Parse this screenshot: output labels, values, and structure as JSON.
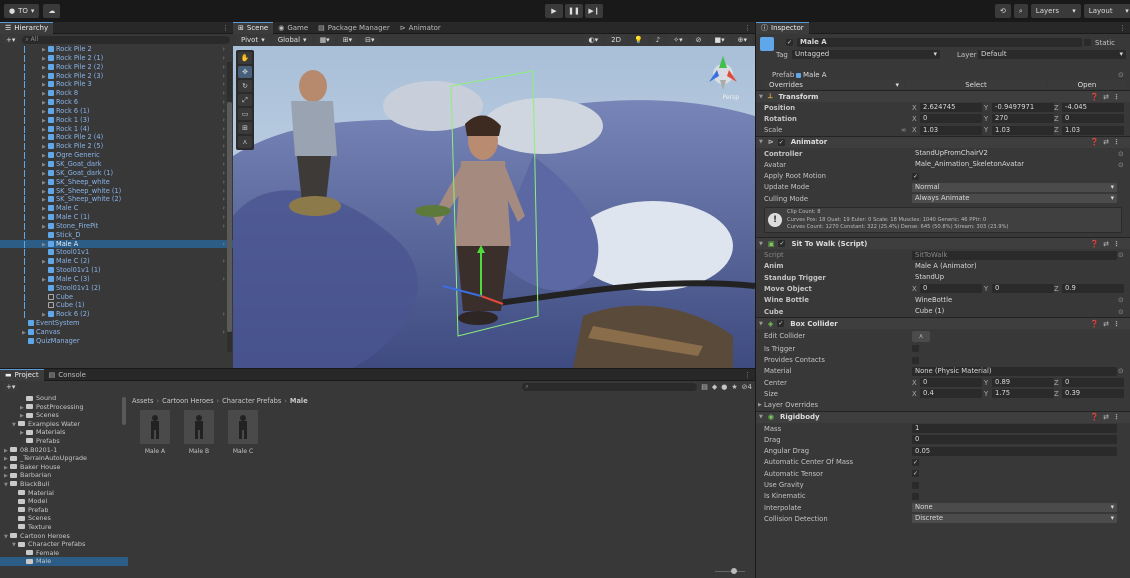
{
  "toolbar": {
    "account": "TO",
    "layers": "Layers",
    "layout": "Layout"
  },
  "hierarchy": {
    "title": "Hierarchy",
    "search": "All",
    "items": [
      {
        "label": "Rock Pile 2",
        "fold": true,
        "type": "prefab"
      },
      {
        "label": "Rock Pile 2 (1)",
        "fold": true,
        "type": "prefab"
      },
      {
        "label": "Rock Pile 2 (2)",
        "fold": true,
        "type": "prefab"
      },
      {
        "label": "Rock Pile 2 (3)",
        "fold": true,
        "type": "prefab"
      },
      {
        "label": "Rock Pile 3",
        "fold": true,
        "type": "prefab"
      },
      {
        "label": "Rock 8",
        "fold": true,
        "type": "prefab"
      },
      {
        "label": "Rock 6",
        "fold": true,
        "type": "prefab"
      },
      {
        "label": "Rock 6 (1)",
        "fold": true,
        "type": "prefab"
      },
      {
        "label": "Rock 1 (3)",
        "fold": true,
        "type": "prefab"
      },
      {
        "label": "Rock 1 (4)",
        "fold": true,
        "type": "prefab"
      },
      {
        "label": "Rock Pile 2 (4)",
        "fold": true,
        "type": "prefab"
      },
      {
        "label": "Rock Pile 2 (5)",
        "fold": true,
        "type": "prefab"
      },
      {
        "label": "Ogre Generic",
        "fold": true,
        "type": "prefab"
      },
      {
        "label": "SK_Goat_dark",
        "fold": true,
        "type": "prefab"
      },
      {
        "label": "SK_Goat_dark (1)",
        "fold": true,
        "type": "prefab"
      },
      {
        "label": "SK_Sheep_white",
        "fold": true,
        "type": "prefab"
      },
      {
        "label": "SK_Sheep_white (1)",
        "fold": true,
        "type": "prefab"
      },
      {
        "label": "SK_Sheep_white (2)",
        "fold": true,
        "type": "prefab"
      },
      {
        "label": "Male C",
        "fold": true,
        "type": "prefab"
      },
      {
        "label": "Male C (1)",
        "fold": true,
        "type": "prefab"
      },
      {
        "label": "Stone_FirePit",
        "fold": true,
        "type": "prefab"
      },
      {
        "label": "Stick_D",
        "fold": false,
        "type": "prefab"
      },
      {
        "label": "Male A",
        "fold": true,
        "type": "prefab",
        "selected": true
      },
      {
        "label": "Stool01v1",
        "fold": false,
        "type": "prefab"
      },
      {
        "label": "Male C (2)",
        "fold": true,
        "type": "prefab"
      },
      {
        "label": "Stool01v1 (1)",
        "fold": false,
        "type": "prefab"
      },
      {
        "label": "Male C (3)",
        "fold": true,
        "type": "prefab"
      },
      {
        "label": "Stool01v1 (2)",
        "fold": false,
        "type": "prefab"
      },
      {
        "label": "Cube",
        "fold": false,
        "type": "object"
      },
      {
        "label": "Cube (1)",
        "fold": false,
        "type": "object"
      },
      {
        "label": "Rock 6 (2)",
        "fold": true,
        "type": "prefab"
      },
      {
        "label": "EventSystem",
        "fold": false,
        "type": "prefab",
        "top": true
      },
      {
        "label": "Canvas",
        "fold": true,
        "type": "prefab",
        "top": true
      },
      {
        "label": "QuizManager",
        "fold": false,
        "type": "prefab",
        "top": true
      }
    ]
  },
  "scene": {
    "tabs": [
      "Scene",
      "Game",
      "Package Manager",
      "Animator"
    ],
    "pivot": "Pivot",
    "global": "Global",
    "mode2d": "2D",
    "persp": "Persp"
  },
  "project": {
    "tabs": [
      "Project",
      "Console"
    ],
    "breadcrumb": [
      "Assets",
      "Cartoon Heroes",
      "Character Prefabs",
      "Male"
    ],
    "tree": [
      {
        "label": "Sound",
        "d": 2
      },
      {
        "label": "PostProcessing",
        "d": 2,
        "f": true
      },
      {
        "label": "Scenes",
        "d": 2,
        "f": true
      },
      {
        "label": "Examples Water",
        "d": 1,
        "o": true
      },
      {
        "label": "Materials",
        "d": 2,
        "f": true
      },
      {
        "label": "Prefabs",
        "d": 2
      },
      {
        "label": "08.B0201-1",
        "d": 0,
        "f": true
      },
      {
        "label": "_TerrainAutoUpgrade",
        "d": 0,
        "f": true
      },
      {
        "label": "Baker House",
        "d": 0,
        "f": true
      },
      {
        "label": "Barbarian",
        "d": 0,
        "f": true
      },
      {
        "label": "BlackBull",
        "d": 0,
        "o": true
      },
      {
        "label": "Material",
        "d": 1
      },
      {
        "label": "Model",
        "d": 1
      },
      {
        "label": "Prefab",
        "d": 1
      },
      {
        "label": "Scenes",
        "d": 1
      },
      {
        "label": "Texture",
        "d": 1
      },
      {
        "label": "Cartoon Heroes",
        "d": 0,
        "o": true
      },
      {
        "label": "Character Prefabs",
        "d": 1,
        "o": true
      },
      {
        "label": "Female",
        "d": 2
      },
      {
        "label": "Male",
        "d": 2,
        "sel": true
      }
    ],
    "assets": [
      "Male A",
      "Male B",
      "Male C"
    ],
    "hidden_count": "4"
  },
  "inspector": {
    "title": "Inspector",
    "name": "Male A",
    "static": "Static",
    "tag_label": "Tag",
    "tag": "Untagged",
    "layer_label": "Layer",
    "layer": "Default",
    "prefab_label": "Prefab",
    "prefab": "Male A",
    "overrides": "Overrides",
    "select": "Select",
    "open": "Open",
    "transform": {
      "title": "Transform",
      "rows": [
        {
          "label": "Position",
          "x": "2.624745",
          "y": "-0.9497971",
          "z": "-4.045"
        },
        {
          "label": "Rotation",
          "x": "0",
          "y": "270",
          "z": "0"
        },
        {
          "label": "Scale",
          "x": "1.03",
          "y": "1.03",
          "z": "1.03"
        }
      ]
    },
    "animator": {
      "title": "Animator",
      "rows": [
        {
          "label": "Controller",
          "value": "StandUpFromChairV2"
        },
        {
          "label": "Avatar",
          "value": "Male_Animation_SkeletonAvatar"
        },
        {
          "label": "Apply Root Motion",
          "value": "✓"
        },
        {
          "label": "Update Mode",
          "value": "Normal"
        },
        {
          "label": "Culling Mode",
          "value": "Always Animate"
        }
      ],
      "info": [
        "Clip Count: 8",
        "Curves Pos: 18 Quat: 19 Euler: 0 Scale: 18 Muscles: 1040 Generic: 46 PPtr: 0",
        "Curves Count: 1270 Constant: 322 (25.4%) Dense: 645 (50.8%) Stream: 303 (23.9%)"
      ]
    },
    "sit": {
      "title": "Sit To Walk (Script)",
      "rows": [
        {
          "label": "Script",
          "value": "SitToWalk"
        },
        {
          "label": "Anim",
          "value": "Male A (Animator)"
        },
        {
          "label": "Standup Trigger",
          "value": "StandUp"
        },
        {
          "label": "Move Object",
          "x": "0",
          "y": "0",
          "z": "0.9"
        },
        {
          "label": "Wine Bottle",
          "value": "WineBottle"
        },
        {
          "label": "Cube",
          "value": "Cube (1)"
        }
      ]
    },
    "box": {
      "title": "Box Collider",
      "edit": "Edit Collider",
      "trigger": "Is Trigger",
      "contacts": "Provides Contacts",
      "material_label": "Material",
      "material": "None (Physic Material)",
      "center": {
        "label": "Center",
        "x": "0",
        "y": "0.89",
        "z": "0"
      },
      "size": {
        "label": "Size",
        "x": "0.4",
        "y": "1.75",
        "z": "0.39"
      },
      "layers": "Layer Overrides"
    },
    "rigid": {
      "title": "Rigidbody",
      "rows": [
        {
          "label": "Mass",
          "value": "1"
        },
        {
          "label": "Drag",
          "value": "0"
        },
        {
          "label": "Angular Drag",
          "value": "0.05"
        },
        {
          "label": "Automatic Center Of Mass",
          "value": "✓"
        },
        {
          "label": "Automatic Tensor",
          "value": "✓"
        },
        {
          "label": "Use Gravity",
          "value": ""
        },
        {
          "label": "Is Kinematic",
          "value": ""
        },
        {
          "label": "Interpolate",
          "value": "None"
        },
        {
          "label": "Collision Detection",
          "value": "Discrete"
        }
      ]
    }
  }
}
